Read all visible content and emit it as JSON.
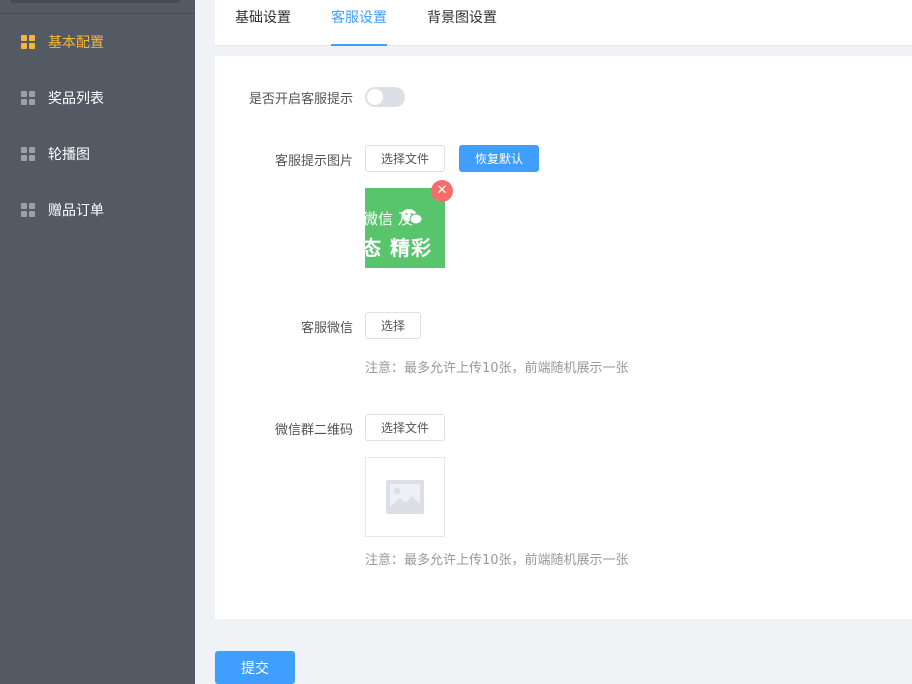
{
  "sidebar": {
    "items": [
      {
        "label": "基本配置",
        "active": true
      },
      {
        "label": "奖品列表",
        "active": false
      },
      {
        "label": "轮播图",
        "active": false
      },
      {
        "label": "赠品订单",
        "active": false
      }
    ]
  },
  "tabs": [
    {
      "label": "基础设置",
      "active": false
    },
    {
      "label": "客服设置",
      "active": true
    },
    {
      "label": "背景图设置",
      "active": false
    }
  ],
  "form": {
    "service_tip": {
      "label": "是否开启客服提示",
      "enabled": false
    },
    "tip_image": {
      "label": "客服提示图片",
      "select_label": "选择文件",
      "reset_label": "恢复默认",
      "thumb_line1": "微信 及",
      "thumb_line2": "态 精彩",
      "remove_symbol": "✕"
    },
    "wechat": {
      "label": "客服微信",
      "select_label": "选择",
      "note": "注意：最多允许上传10张，前端随机展示一张"
    },
    "group_qr": {
      "label": "微信群二维码",
      "select_label": "选择文件",
      "note": "注意：最多允许上传10张，前端随机展示一张"
    }
  },
  "submit_label": "提交",
  "colors": {
    "sidebar_bg": "#535a64",
    "accent_active_menu": "#f5b53a",
    "primary": "#409eff",
    "danger": "#f56c6c",
    "thumb_green": "#58c46c"
  },
  "icons": [
    "grid-icon",
    "close-icon",
    "wechat-icon",
    "image-placeholder-icon"
  ]
}
